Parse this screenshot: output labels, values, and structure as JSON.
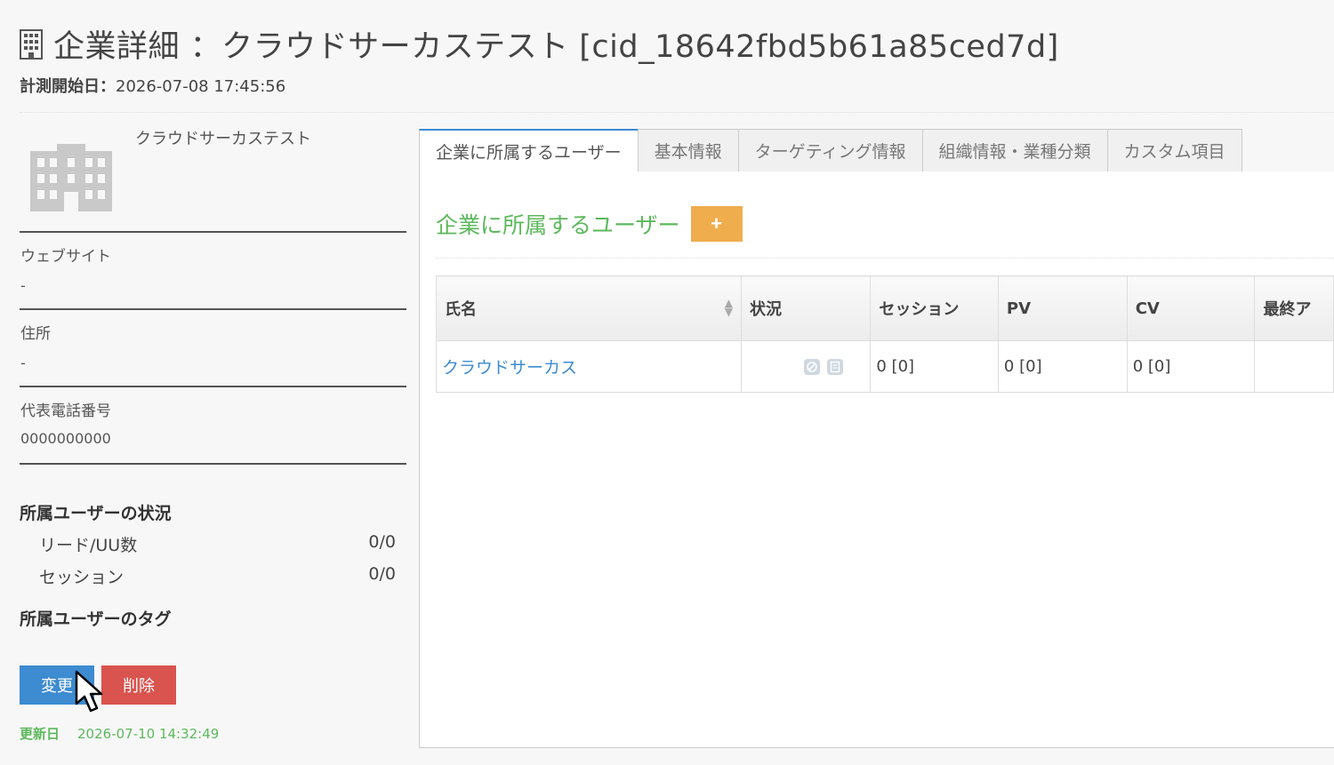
{
  "header": {
    "title": "企業詳細 ：クラウドサーカステスト [cid_18642fbd5b61a85ced7d]",
    "measure_label": "計測開始日：",
    "measure_value": "2026-07-08 17:45:56"
  },
  "company": {
    "name": "クラウドサーカステスト",
    "fields": [
      {
        "label": "ウェブサイト",
        "value": "-"
      },
      {
        "label": "住所",
        "value": "-"
      },
      {
        "label": "代表電話番号",
        "value": "0000000000"
      }
    ],
    "status_heading": "所属ユーザーの状況",
    "stats": [
      {
        "label": "リード/UU数",
        "value": "0/0"
      },
      {
        "label": "セッション",
        "value": "0/0"
      }
    ],
    "tags_heading": "所属ユーザーのタグ",
    "edit_label": "変更",
    "delete_label": "削除",
    "updated_label": "更新日",
    "updated_value": "2026-07-10 14:32:49"
  },
  "tabs": [
    {
      "label": "企業に所属するユーザー",
      "active": true
    },
    {
      "label": "基本情報",
      "active": false
    },
    {
      "label": "ターゲティング情報",
      "active": false
    },
    {
      "label": "組織情報・業種分類",
      "active": false
    },
    {
      "label": "カスタム項目",
      "active": false
    }
  ],
  "panel": {
    "title": "企業に所属するユーザー",
    "add_label": "+"
  },
  "table": {
    "headers": [
      "氏名",
      "状況",
      "セッション",
      "PV",
      "CV",
      "最終ア"
    ],
    "rows": [
      {
        "name": "クラウドサーカス",
        "session": "0 [0]",
        "pv": "0 [0]",
        "cv": "0 [0]",
        "last": ""
      }
    ]
  },
  "colors": {
    "accent_blue": "#3d8bd0",
    "danger_red": "#d9534f",
    "success_green": "#5cb85c",
    "warning_orange": "#f0ad4e"
  }
}
